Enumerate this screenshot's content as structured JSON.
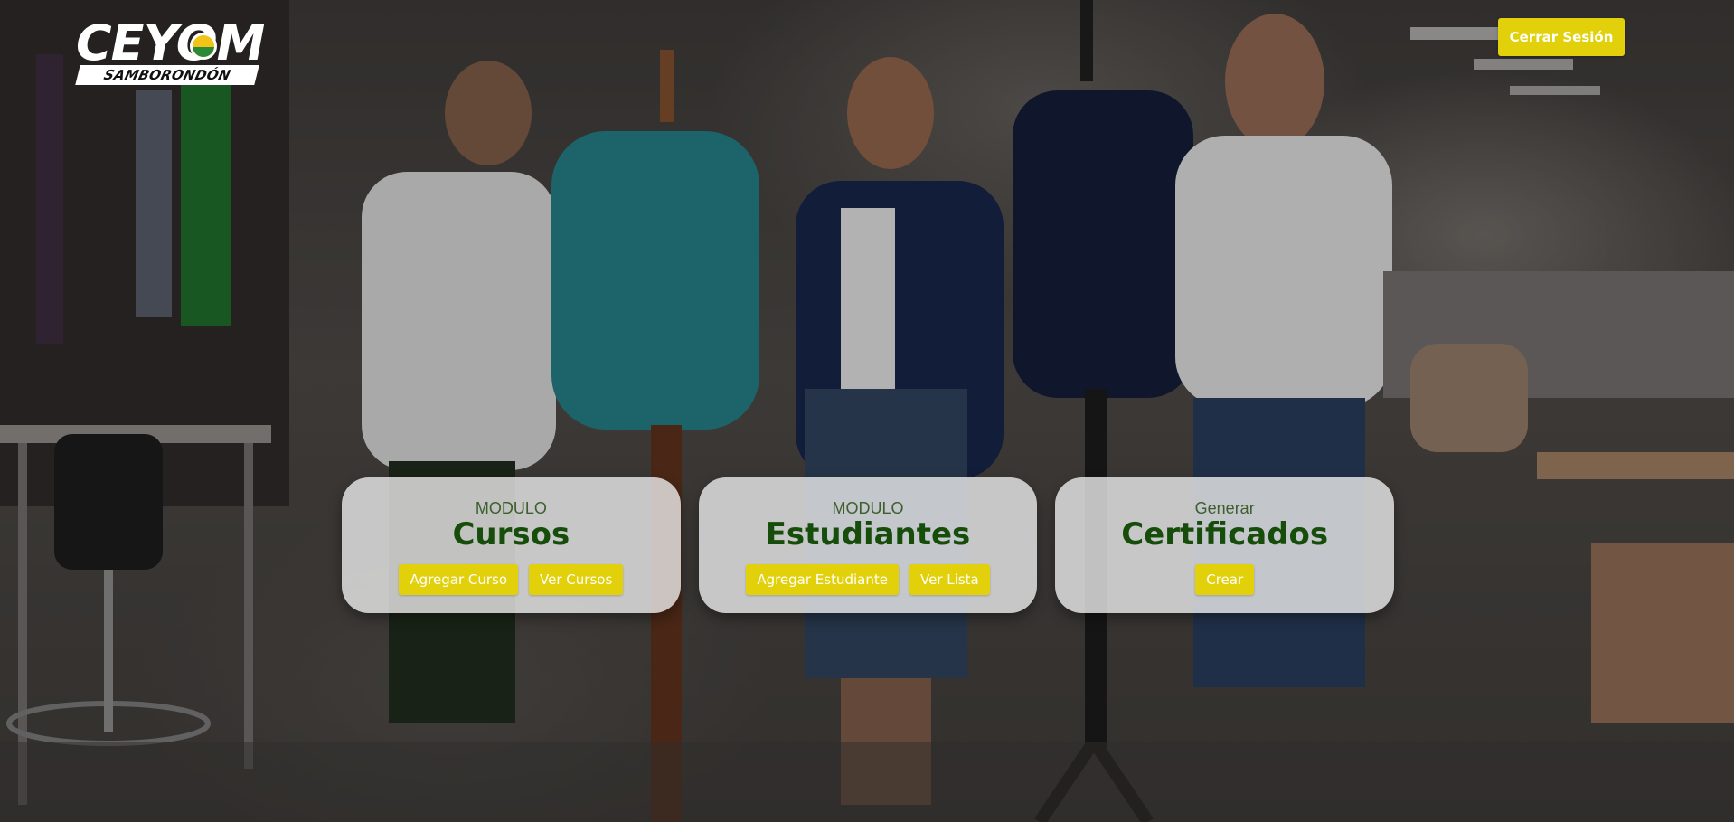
{
  "brand": {
    "name": "CEYOM",
    "location": "SAMBORONDÓN"
  },
  "header": {
    "logout_label": "Cerrar Sesión"
  },
  "modules": [
    {
      "kicker": "MODULO",
      "title": "Cursos",
      "actions": [
        "Agregar Curso",
        "Ver Cursos"
      ]
    },
    {
      "kicker": "MODULO",
      "title": "Estudiantes",
      "actions": [
        "Agregar Estudiante",
        "Ver Lista"
      ]
    },
    {
      "kicker": "Generar",
      "title": "Certificados",
      "actions": [
        "Crear"
      ]
    }
  ],
  "colors": {
    "accent_yellow": "#e2d10a",
    "title_green": "#174d0b",
    "kicker_green": "#3c5f2c",
    "card_bg": "#ececec"
  }
}
